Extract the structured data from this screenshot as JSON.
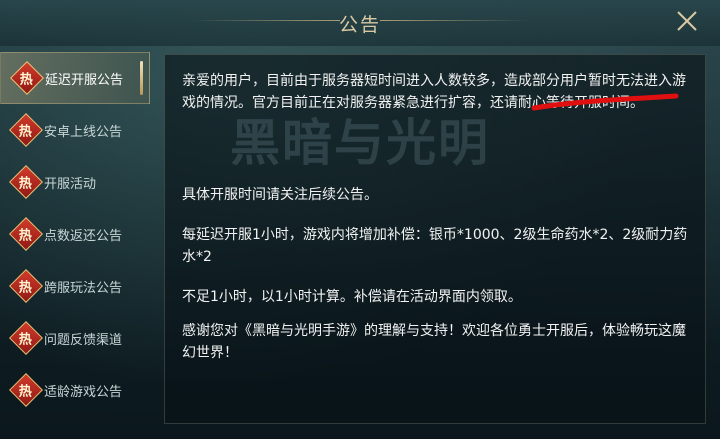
{
  "header": {
    "title": "公告"
  },
  "sidebar": {
    "badge": "热",
    "items": [
      {
        "label": "延迟开服公告",
        "active": true
      },
      {
        "label": "安卓上线公告",
        "active": false
      },
      {
        "label": "开服活动",
        "active": false
      },
      {
        "label": "点数返还公告",
        "active": false
      },
      {
        "label": "跨服玩法公告",
        "active": false
      },
      {
        "label": "问题反馈渠道",
        "active": false
      },
      {
        "label": "适龄游戏公告",
        "active": false
      }
    ]
  },
  "content": {
    "watermark": "黑暗与光明",
    "paragraphs": [
      "亲爱的用户，目前由于服务器短时间进入人数较多，造成部分用户暂时无法进入游戏的情况。官方目前正在对服务器紧急进行扩容，还请耐心等待开服时间。",
      "具体开服时间请关注后续公告。",
      "每延迟开服1小时，游戏内将增加补偿：银币*1000、2级生命药水*2、2级耐力药水*2",
      "不足1小时，以1小时计算。补偿请在活动界面内领取。",
      "感谢您对《黑暗与光明手游》的理解与支持！欢迎各位勇士开服后，体验畅玩这魔幻世界！"
    ]
  },
  "colors": {
    "accent": "#d9c9a3",
    "badge": "#c0302a",
    "annotation": "#e01010"
  }
}
